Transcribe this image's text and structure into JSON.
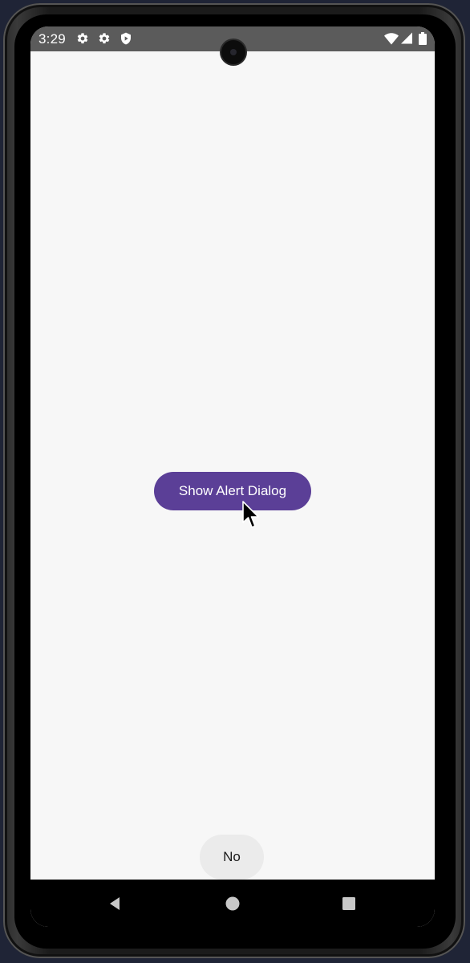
{
  "status_bar": {
    "time": "3:29",
    "left_icons": [
      "settings-gear-icon",
      "settings-gear-icon",
      "shield-play-icon"
    ],
    "right_icons": [
      "wifi-icon",
      "cell-signal-icon",
      "battery-icon"
    ],
    "background_color": "#5b5b5b"
  },
  "main": {
    "primary_button_label": "Show Alert Dialog",
    "primary_button_color": "#5b3f97",
    "secondary_button_label": "No",
    "secondary_button_color": "#ebebeb",
    "background_color": "#f7f7f7"
  },
  "nav_bar": {
    "icons": [
      "back-icon",
      "home-icon",
      "recents-icon"
    ],
    "background_color": "#000000"
  }
}
